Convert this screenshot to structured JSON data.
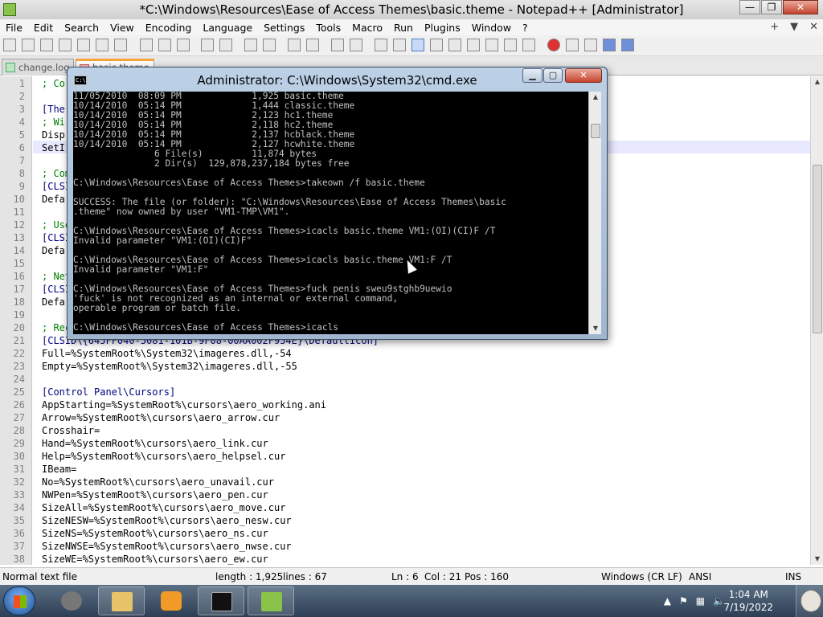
{
  "npp": {
    "title": "*C:\\Windows\\Resources\\Ease of Access Themes\\basic.theme - Notepad++ [Administrator]",
    "window_buttons": {
      "minimize": "—",
      "maximize": "❐",
      "close": "✕"
    },
    "menu": [
      "File",
      "Edit",
      "Search",
      "View",
      "Encoding",
      "Language",
      "Settings",
      "Tools",
      "Macro",
      "Run",
      "Plugins",
      "Window",
      "?"
    ],
    "menu_right": {
      "plus": "+",
      "dropdown": "▼",
      "close": "✕"
    },
    "tabs": [
      {
        "label": "change.log",
        "active": false
      },
      {
        "label": "basic.theme",
        "active": true
      }
    ],
    "lines": [
      {
        "n": "1",
        "t": "; Co"
      },
      {
        "n": "2",
        "t": ""
      },
      {
        "n": "3",
        "t": "[The"
      },
      {
        "n": "4",
        "t": "; Wi"
      },
      {
        "n": "5",
        "t": "Disp"
      },
      {
        "n": "6",
        "t": "SetI"
      },
      {
        "n": "7",
        "t": ""
      },
      {
        "n": "8",
        "t": "; Com"
      },
      {
        "n": "9",
        "t": "[CLSI"
      },
      {
        "n": "10",
        "t": "Defa"
      },
      {
        "n": "11",
        "t": ""
      },
      {
        "n": "12",
        "t": "; Use"
      },
      {
        "n": "13",
        "t": "[CLSI"
      },
      {
        "n": "14",
        "t": "Defa"
      },
      {
        "n": "15",
        "t": ""
      },
      {
        "n": "16",
        "t": "; Net"
      },
      {
        "n": "17",
        "t": "[CLSI"
      },
      {
        "n": "18",
        "t": "Defa"
      },
      {
        "n": "19",
        "t": ""
      },
      {
        "n": "20",
        "t": "; Rec"
      },
      {
        "n": "21",
        "t": "[CLSID\\{645FF040-5081-101B-9F08-00AA002F954E}\\DefaultIcon]"
      },
      {
        "n": "22",
        "t": "Full=%SystemRoot%\\System32\\imageres.dll,-54"
      },
      {
        "n": "23",
        "t": "Empty=%SystemRoot%\\System32\\imageres.dll,-55"
      },
      {
        "n": "24",
        "t": ""
      },
      {
        "n": "25",
        "t": "[Control Panel\\Cursors]"
      },
      {
        "n": "26",
        "t": "AppStarting=%SystemRoot%\\cursors\\aero_working.ani"
      },
      {
        "n": "27",
        "t": "Arrow=%SystemRoot%\\cursors\\aero_arrow.cur"
      },
      {
        "n": "28",
        "t": "Crosshair="
      },
      {
        "n": "29",
        "t": "Hand=%SystemRoot%\\cursors\\aero_link.cur"
      },
      {
        "n": "30",
        "t": "Help=%SystemRoot%\\cursors\\aero_helpsel.cur"
      },
      {
        "n": "31",
        "t": "IBeam="
      },
      {
        "n": "32",
        "t": "No=%SystemRoot%\\cursors\\aero_unavail.cur"
      },
      {
        "n": "33",
        "t": "NWPen=%SystemRoot%\\cursors\\aero_pen.cur"
      },
      {
        "n": "34",
        "t": "SizeAll=%SystemRoot%\\cursors\\aero_move.cur"
      },
      {
        "n": "35",
        "t": "SizeNESW=%SystemRoot%\\cursors\\aero_nesw.cur"
      },
      {
        "n": "36",
        "t": "SizeNS=%SystemRoot%\\cursors\\aero_ns.cur"
      },
      {
        "n": "37",
        "t": "SizeNWSE=%SystemRoot%\\cursors\\aero_nwse.cur"
      },
      {
        "n": "38",
        "t": "SizeWE=%SystemRoot%\\cursors\\aero_ew.cur"
      }
    ],
    "status": {
      "type": "Normal text file",
      "length": "length : 1,925",
      "lines": "lines : 67",
      "ln": "Ln : 6",
      "col": "Col : 21",
      "pos": "Pos : 160",
      "eol": "Windows (CR LF)",
      "encoding": "ANSI",
      "mode": "INS"
    }
  },
  "cmd": {
    "title": "Administrator: C:\\Windows\\System32\\cmd.exe",
    "icon_text": "C:\\",
    "buttons": {
      "minimize": "▁",
      "maximize": "▢",
      "close": "✕"
    },
    "lines": [
      "11/05/2010  08:09 PM             1,925 basic.theme",
      "10/14/2010  05:14 PM             1,444 classic.theme",
      "10/14/2010  05:14 PM             2,123 hc1.theme",
      "10/14/2010  05:14 PM             2,118 hc2.theme",
      "10/14/2010  05:14 PM             2,137 hcblack.theme",
      "10/14/2010  05:14 PM             2,127 hcwhite.theme",
      "               6 File(s)         11,874 bytes",
      "               2 Dir(s)  129,878,237,184 bytes free",
      "",
      "C:\\Windows\\Resources\\Ease of Access Themes>takeown /f basic.theme",
      "",
      "SUCCESS: The file (or folder): \"C:\\Windows\\Resources\\Ease of Access Themes\\basic",
      ".theme\" now owned by user \"VM1-TMP\\VM1\".",
      "",
      "C:\\Windows\\Resources\\Ease of Access Themes>icacls basic.theme VM1:(OI)(CI)F /T",
      "Invalid parameter \"VM1:(OI)(CI)F\"",
      "",
      "C:\\Windows\\Resources\\Ease of Access Themes>icacls basic.theme VM1:F /T",
      "Invalid parameter \"VM1:F\"",
      "",
      "C:\\Windows\\Resources\\Ease of Access Themes>fuck penis sweu9stghb9uewio",
      "'fuck' is not recognized as an internal or external command,",
      "operable program or batch file.",
      "",
      "C:\\Windows\\Resources\\Ease of Access Themes>icacls"
    ]
  },
  "taskbar": {
    "apps": [
      "media-center-raccoon-icon",
      "file-explorer-icon",
      "media-player-icon",
      "cmd-icon",
      "notepadpp-icon"
    ],
    "clock_time": "1:04 AM",
    "clock_date": "7/19/2022",
    "tray_arrow": "▲"
  },
  "colors": {
    "npp_accent": "#f7a13a",
    "taskbar_top": "#5a6e84",
    "taskbar_bottom": "#2d3f55",
    "cmd_bg": "#000000",
    "cmd_fg": "#c0c0c0"
  }
}
